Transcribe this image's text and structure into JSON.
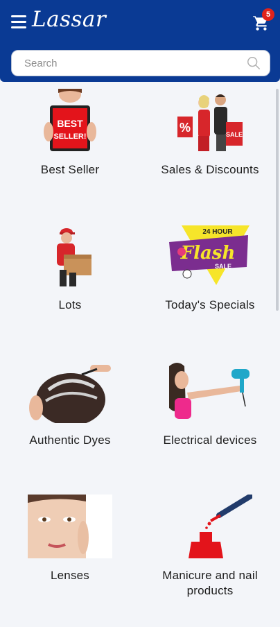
{
  "header": {
    "logo_text": "Lassar",
    "cart_count": "5"
  },
  "search": {
    "placeholder": "Search"
  },
  "colors": {
    "appbar": "#0a3a94",
    "badge": "#e2231a",
    "background": "#f3f5f9"
  },
  "categories": [
    {
      "label": "Best Seller",
      "icon": "best-seller-tablet-image"
    },
    {
      "label": "Sales & Discounts",
      "icon": "shopping-people-image"
    },
    {
      "label": "Lots",
      "icon": "delivery-man-box-image"
    },
    {
      "label": "Today's Specials",
      "icon": "flash-sale-banner-image"
    },
    {
      "label": "Authentic Dyes",
      "icon": "hair-dye-image"
    },
    {
      "label": "Electrical devices",
      "icon": "hair-dryer-woman-image"
    },
    {
      "label": "Lenses",
      "icon": "woman-face-lenses-image"
    },
    {
      "label": "Manicure and nail products",
      "icon": "nail-polish-image"
    }
  ],
  "promo": {
    "best_seller_text": "BEST SELLER!",
    "percent": "%",
    "sale": "SALE",
    "flash_top": "24 HOUR",
    "flash_main": "Flash",
    "flash_sale": "SALE"
  }
}
